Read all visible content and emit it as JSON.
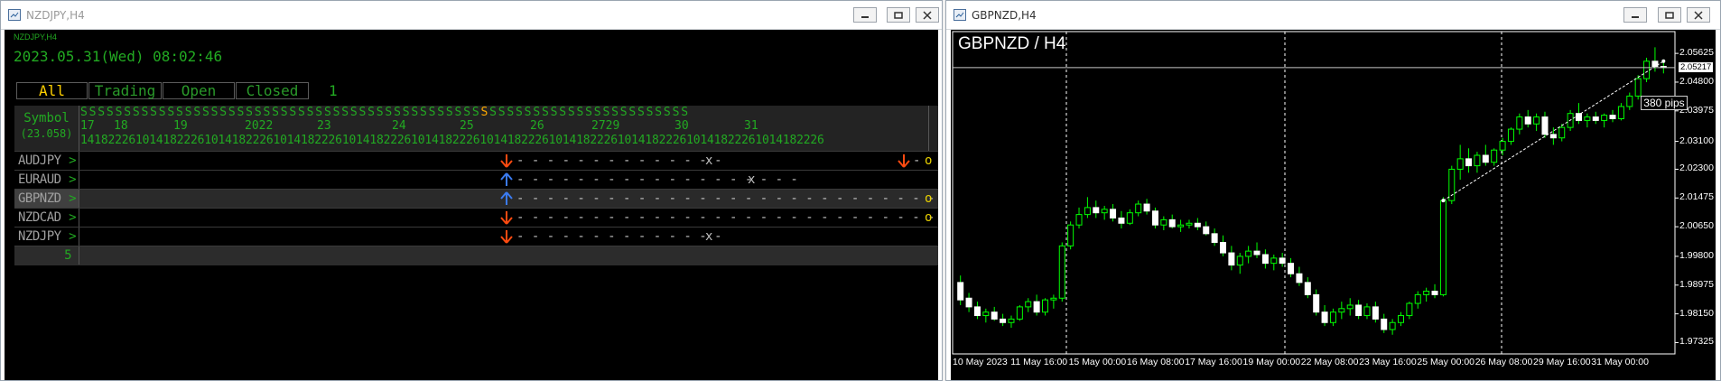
{
  "left_window": {
    "title": "NZDJPY,H4",
    "chart_label": "NZDJPY,H4",
    "datetime": "2023.05.31(Wed) 08:02:46",
    "tabs": [
      "All",
      "Trading",
      "Open",
      "Closed"
    ],
    "tab_count": "1",
    "header": {
      "symbol_label": "Symbol",
      "symbol_value": "(23.058)",
      "s_row": "SSSSSSSSSSSSSSSSSSSSSSSSSSSSSSSSSSSSSSSSSSSSSSSSSSSSSSSSSSSSSSSSSSSSSS",
      "highlight_s": "S",
      "day_labels": [
        "17",
        "18",
        "19",
        "2022",
        "23",
        "24",
        "25",
        "26",
        "2729",
        "30",
        "31"
      ],
      "hour_labels": [
        "141822",
        "2",
        "6",
        "101418",
        "22",
        "2",
        "6",
        "101418",
        "22",
        "2",
        "6",
        "101418",
        "22",
        "2",
        "6",
        "101418",
        "22",
        "2",
        "6",
        "101418",
        "22",
        "2",
        "6",
        "101418",
        "22",
        "2",
        "6",
        "101418",
        "22",
        "2",
        "6",
        "101418",
        "22",
        "2",
        "6",
        "101418",
        "22",
        "2",
        "6",
        "101418",
        "22",
        "2",
        "6"
      ]
    },
    "rows": [
      {
        "symbol": "AUDJPY",
        "trade": "- - - - - - - - - - - - - -",
        "end": "x",
        "extra_arrow": "down",
        "extra_tail": "-",
        "status": "o"
      },
      {
        "symbol": "EURAUD",
        "trade": "- - - - - - - - - - - - - - - - - - -",
        "end": "x"
      },
      {
        "symbol": "GBPNZD",
        "trade": "- - - - - - - - - - - - - - - - - - - - - - - - - - - - - - - - - -",
        "status": "o"
      },
      {
        "symbol": "NZDCAD",
        "trade": "- - - - - - - - - - - - - - - - - - - - - - - - - - - - - - - - - -",
        "status": "o"
      },
      {
        "symbol": "NZDJPY",
        "trade": "- - - - - - - - - - - - - -",
        "end": "x"
      }
    ],
    "footer_count": "5"
  },
  "right_window": {
    "title": "GBPNZD,H4",
    "chart_title": "GBPNZD / H4",
    "price_tag": "2.05217",
    "annotation": "380 pips",
    "colors": {
      "bull": "#00ff00",
      "bear": "#00ff00",
      "price_tag_bg": "#ffffff"
    }
  },
  "chart_data": {
    "type": "line",
    "title": "GBPNZD / H4",
    "x": [
      "10 May 2023",
      "11 May 16:00",
      "15 May 00:00",
      "16 May 08:00",
      "17 May 16:00",
      "19 May 00:00",
      "22 May 08:00",
      "23 May 16:00",
      "25 May 00:00",
      "26 May 08:00",
      "29 May 16:00",
      "31 May 00:00"
    ],
    "y_ticks": [
      "2.05625",
      "2.04800",
      "2.03975",
      "2.03100",
      "2.02300",
      "2.01475",
      "2.00650",
      "1.99800",
      "1.98975",
      "1.98150",
      "1.97325"
    ],
    "ylim": [
      1.97,
      2.0625
    ],
    "current_price": 2.05217,
    "candles": [
      [
        1.9905,
        1.9925,
        1.984,
        1.9855
      ],
      [
        1.986,
        1.9875,
        1.982,
        1.9835
      ],
      [
        1.9835,
        1.985,
        1.98,
        1.981
      ],
      [
        1.981,
        1.983,
        1.979,
        1.982
      ],
      [
        1.982,
        1.9835,
        1.9795,
        1.98
      ],
      [
        1.98,
        1.9815,
        1.978,
        1.979
      ],
      [
        1.979,
        1.981,
        1.9775,
        1.98
      ],
      [
        1.98,
        1.984,
        1.9795,
        1.9835
      ],
      [
        1.9835,
        1.986,
        1.982,
        1.985
      ],
      [
        1.985,
        1.987,
        1.981,
        1.982
      ],
      [
        1.982,
        1.986,
        1.981,
        1.9855
      ],
      [
        1.9855,
        1.987,
        1.983,
        1.986
      ],
      [
        1.986,
        2.002,
        1.985,
        2.001
      ],
      [
        2.001,
        2.008,
        2.0,
        2.007
      ],
      [
        2.007,
        2.012,
        2.006,
        2.01
      ],
      [
        2.01,
        2.015,
        2.009,
        2.012
      ],
      [
        2.012,
        2.014,
        2.009,
        2.0105
      ],
      [
        2.0105,
        2.0125,
        2.0085,
        2.0115
      ],
      [
        2.0115,
        2.013,
        2.008,
        2.009
      ],
      [
        2.009,
        2.011,
        2.006,
        2.0075
      ],
      [
        2.0075,
        2.0115,
        2.007,
        2.0105
      ],
      [
        2.0105,
        2.014,
        2.0095,
        2.013
      ],
      [
        2.013,
        2.0145,
        2.01,
        2.011
      ],
      [
        2.011,
        2.012,
        2.006,
        2.007
      ],
      [
        2.007,
        2.0095,
        2.0055,
        2.0085
      ],
      [
        2.0085,
        2.01,
        2.006,
        2.0065
      ],
      [
        2.0065,
        2.0085,
        2.005,
        2.007
      ],
      [
        2.007,
        2.0085,
        2.006,
        2.0075
      ],
      [
        2.0075,
        2.009,
        2.0055,
        2.0065
      ],
      [
        2.0065,
        2.008,
        2.004,
        2.0045
      ],
      [
        2.0045,
        2.006,
        2.001,
        2.002
      ],
      [
        2.002,
        2.004,
        1.998,
        1.999
      ],
      [
        1.999,
        2.001,
        1.994,
        1.9955
      ],
      [
        1.9955,
        1.999,
        1.993,
        1.998
      ],
      [
        1.998,
        2.001,
        1.996,
        1.9995
      ],
      [
        1.9995,
        2.002,
        1.9975,
        1.9985
      ],
      [
        1.9985,
        2.0,
        1.9945,
        1.996
      ],
      [
        1.996,
        1.9985,
        1.994,
        1.9975
      ],
      [
        1.9975,
        1.999,
        1.995,
        1.996
      ],
      [
        1.996,
        1.9975,
        1.992,
        1.993
      ],
      [
        1.993,
        1.995,
        1.9895,
        1.9905
      ],
      [
        1.9905,
        1.992,
        1.986,
        1.987
      ],
      [
        1.987,
        1.9885,
        1.981,
        1.982
      ],
      [
        1.982,
        1.984,
        1.978,
        1.979
      ],
      [
        1.979,
        1.983,
        1.978,
        1.982
      ],
      [
        1.982,
        1.985,
        1.98,
        1.983
      ],
      [
        1.983,
        1.986,
        1.981,
        1.984
      ],
      [
        1.984,
        1.9855,
        1.98,
        1.981
      ],
      [
        1.981,
        1.9845,
        1.98,
        1.9835
      ],
      [
        1.9835,
        1.985,
        1.979,
        1.98
      ],
      [
        1.98,
        1.9815,
        1.976,
        1.977
      ],
      [
        1.977,
        1.98,
        1.9755,
        1.979
      ],
      [
        1.979,
        1.982,
        1.978,
        1.981
      ],
      [
        1.981,
        1.985,
        1.98,
        1.9845
      ],
      [
        1.9845,
        1.988,
        1.983,
        1.987
      ],
      [
        1.987,
        1.989,
        1.985,
        1.988
      ],
      [
        1.988,
        1.99,
        1.986,
        1.987
      ],
      [
        1.987,
        2.015,
        1.9865,
        2.014
      ],
      [
        2.014,
        2.024,
        2.013,
        2.023
      ],
      [
        2.023,
        2.03,
        2.02,
        2.026
      ],
      [
        2.026,
        2.029,
        2.022,
        2.024
      ],
      [
        2.024,
        2.028,
        2.022,
        2.027
      ],
      [
        2.027,
        2.03,
        2.024,
        2.025
      ],
      [
        2.025,
        2.029,
        2.024,
        2.0285
      ],
      [
        2.0285,
        2.032,
        2.027,
        2.031
      ],
      [
        2.031,
        2.035,
        2.03,
        2.0345
      ],
      [
        2.0345,
        2.039,
        2.033,
        2.038
      ],
      [
        2.038,
        2.04,
        2.035,
        2.036
      ],
      [
        2.036,
        2.039,
        2.034,
        2.038
      ],
      [
        2.038,
        2.0395,
        2.032,
        2.033
      ],
      [
        2.033,
        2.035,
        2.03,
        2.032
      ],
      [
        2.032,
        2.036,
        2.031,
        2.035
      ],
      [
        2.035,
        2.04,
        2.034,
        2.039
      ],
      [
        2.039,
        2.042,
        2.036,
        2.037
      ],
      [
        2.037,
        2.039,
        2.035,
        2.038
      ],
      [
        2.038,
        2.0395,
        2.036,
        2.037
      ],
      [
        2.037,
        2.039,
        2.035,
        2.0385
      ],
      [
        2.0385,
        2.04,
        2.0365,
        2.0375
      ],
      [
        2.0375,
        2.042,
        2.037,
        2.041
      ],
      [
        2.041,
        2.045,
        2.04,
        2.044
      ],
      [
        2.044,
        2.05,
        2.043,
        2.049
      ],
      [
        2.049,
        2.055,
        2.048,
        2.054
      ],
      [
        2.054,
        2.058,
        2.051,
        2.0525
      ],
      [
        2.0525,
        2.0545,
        2.0505,
        2.0522
      ]
    ]
  }
}
